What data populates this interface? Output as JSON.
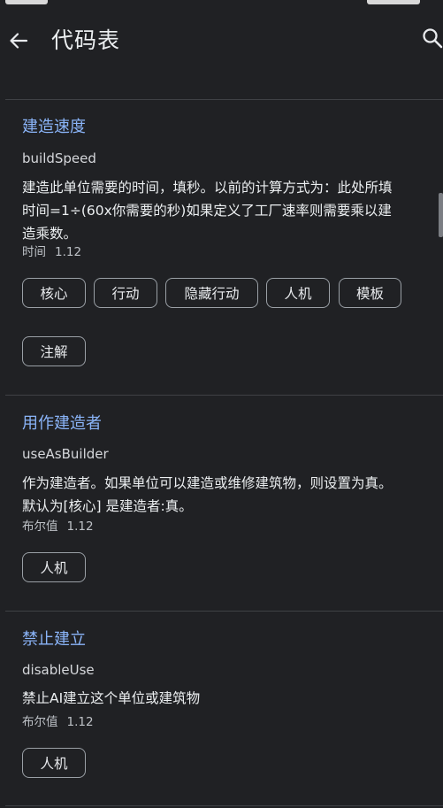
{
  "app_bar": {
    "title": "代码表"
  },
  "entries": [
    {
      "title": "建造速度",
      "key": "buildSpeed",
      "description_lines": [
        "建造此单位需要的时间，填秒。以前的计算方式为：此处所填",
        "时间=1÷(60x你需要的秒)如果定义了工厂速率则需要乘以建",
        "造乘数。"
      ],
      "type": "时间",
      "version": "1.12",
      "tags": [
        "核心",
        "行动",
        "隐藏行动",
        "人机",
        "模板",
        "注解"
      ]
    },
    {
      "title": "用作建造者",
      "key": "useAsBuilder",
      "description_lines": [
        "作为建造者。如果单位可以建造或维修建筑物，则设置为真。",
        "默认为[核心] 是建造者:真。"
      ],
      "type": "布尔值",
      "version": "1.12",
      "tags": [
        "人机"
      ]
    },
    {
      "title": "禁止建立",
      "key": "disableUse",
      "description_lines": [
        "禁止AI建立这个单位或建筑物"
      ],
      "type": "布尔值",
      "version": "1.12",
      "tags": [
        "人机"
      ]
    }
  ],
  "icons": {
    "back": "arrow-back-icon",
    "search": "search-icon"
  },
  "colors": {
    "background": "#202124",
    "title_accent": "#8ab4f8",
    "chip_border": "#9aa0a6",
    "divider": "#3f4145"
  }
}
